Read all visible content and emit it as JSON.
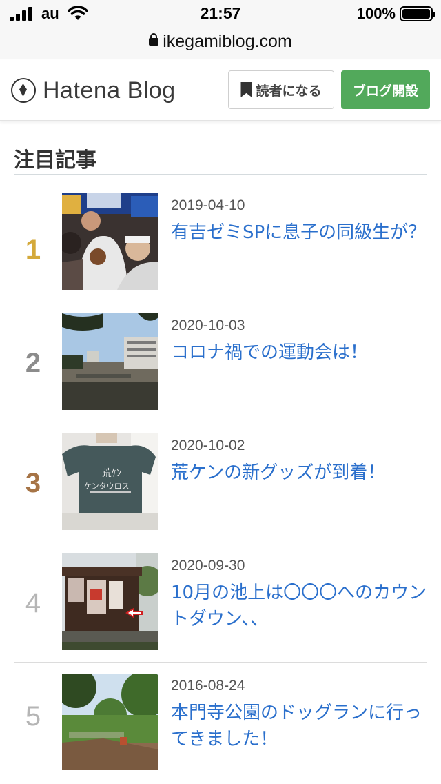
{
  "status": {
    "carrier": "au",
    "time": "21:57",
    "battery": "100%",
    "battery_level": 1.0
  },
  "browser": {
    "url": "ikegamiblog.com"
  },
  "header": {
    "logo": "Hatena Blog",
    "reader_button": "読者になる",
    "open_blog_button": "ブログ開設",
    "accent_color": "#52a95b"
  },
  "section": {
    "title": "注目記事"
  },
  "articles": [
    {
      "rank": "1",
      "rank_color": "#d4a93a",
      "date": "2019-04-10",
      "title": "有吉ゼミSPに息子の同級生が？"
    },
    {
      "rank": "2",
      "rank_color": "#8c8c8c",
      "date": "2020-10-03",
      "title": "コロナ禍での運動会は！"
    },
    {
      "rank": "3",
      "rank_color": "#a67446",
      "date": "2020-10-02",
      "title": "荒ケンの新グッズが到着！"
    },
    {
      "rank": "4",
      "rank_color": "#b5b5b5",
      "date": "2020-09-30",
      "title": "10月の池上は〇〇〇へのカウントダウン、、"
    },
    {
      "rank": "5",
      "rank_color": "#b5b5b5",
      "date": "2016-08-24",
      "title": "本門寺公園のドッグランに行ってきました！"
    }
  ]
}
